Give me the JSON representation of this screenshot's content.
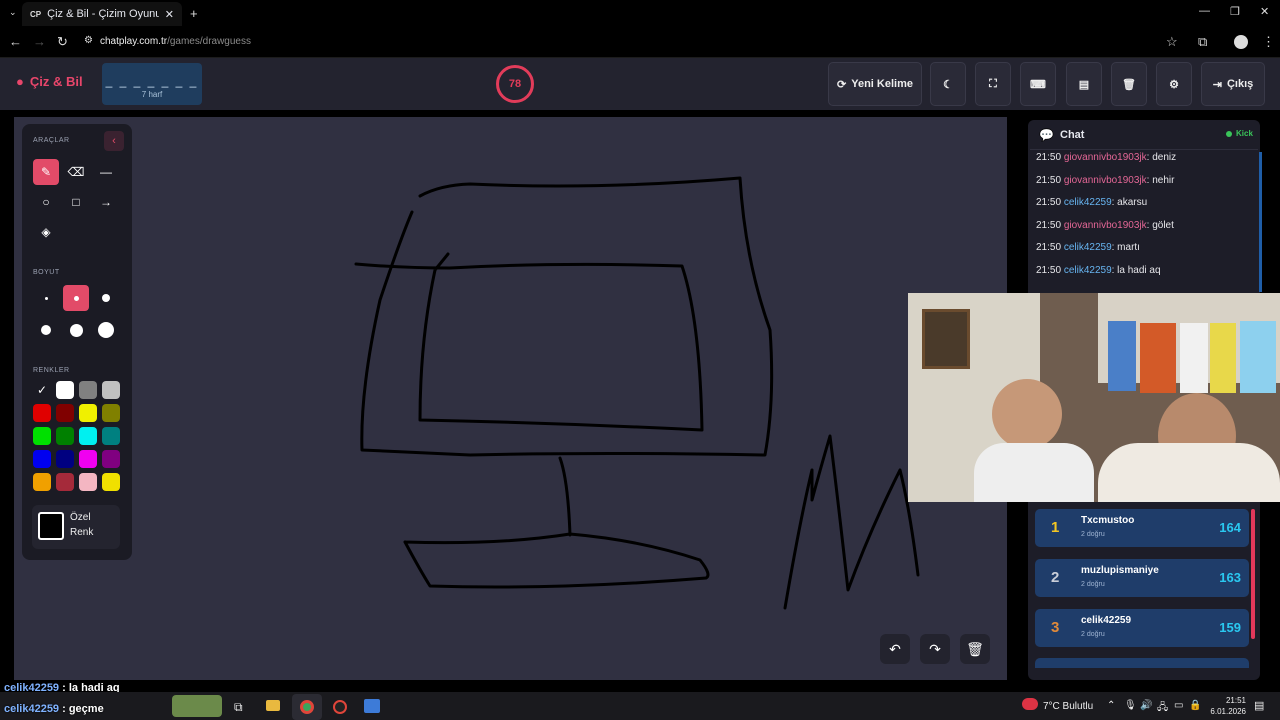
{
  "browser": {
    "tab_title": "Çiz & Bil - Çizim Oyunu",
    "tab_favicon_text": "CP",
    "url_host": "chatplay.com.tr",
    "url_path": "/games/drawguess"
  },
  "header": {
    "logo": "Çiz & Bil",
    "word_hint": "_ _ _ _ _ _ _",
    "letter_count": "7 harf",
    "timer": "78",
    "new_word_label": "Yeni Kelime",
    "exit_label": "Çıkış"
  },
  "tools": {
    "section_tools": "ARAÇLAR",
    "section_size": "BOYUT",
    "section_colors": "RENKLER",
    "custom_color_line1": "Özel",
    "custom_color_line2": "Renk",
    "colors": [
      "#000000",
      "#ffffff",
      "#808080",
      "#c0c0c0",
      "#e00000",
      "#800000",
      "#f0f000",
      "#808000",
      "#00e000",
      "#008000",
      "#00f0f0",
      "#008080",
      "#0000f0",
      "#000080",
      "#f000f0",
      "#800080",
      "#f0a000",
      "#a52a3a",
      "#f4b6c2",
      "#f0e000"
    ]
  },
  "chat": {
    "title": "Chat",
    "platform": "Kick",
    "messages": [
      {
        "time": "21:50",
        "user": "giovannivbo1903jk",
        "text": ": deniz",
        "color": "u1"
      },
      {
        "time": "21:50",
        "user": "giovannivbo1903jk",
        "text": ": nehir",
        "color": "u1"
      },
      {
        "time": "21:50",
        "user": "celik42259",
        "text": ": akarsu",
        "color": "u2"
      },
      {
        "time": "21:50",
        "user": "giovannivbo1903jk",
        "text": ": gölet",
        "color": "u1"
      },
      {
        "time": "21:50",
        "user": "celik42259",
        "text": ": martı",
        "color": "u2"
      },
      {
        "time": "21:50",
        "user": "celik42259",
        "text": ": la hadi aq",
        "color": "u2"
      }
    ]
  },
  "leaderboard": [
    {
      "rank": "1",
      "name": "Txcmustoo",
      "sub": "2 doğru",
      "score": "164",
      "rank_color": "#f3c623"
    },
    {
      "rank": "2",
      "name": "muzlupismaniye",
      "sub": "2 doğru",
      "score": "163",
      "rank_color": "#c9ced8"
    },
    {
      "rank": "3",
      "name": "celik42259",
      "sub": "2 doğru",
      "score": "159",
      "rank_color": "#e08a3a"
    }
  ],
  "overlay": [
    {
      "user": "celik42259",
      "text": " : la hadi aq"
    },
    {
      "user": "celik42259",
      "text": " : geçme"
    }
  ],
  "taskbar": {
    "weather": "7°C  Bulutlu",
    "time": "21:51",
    "date": "6.01.2026"
  }
}
